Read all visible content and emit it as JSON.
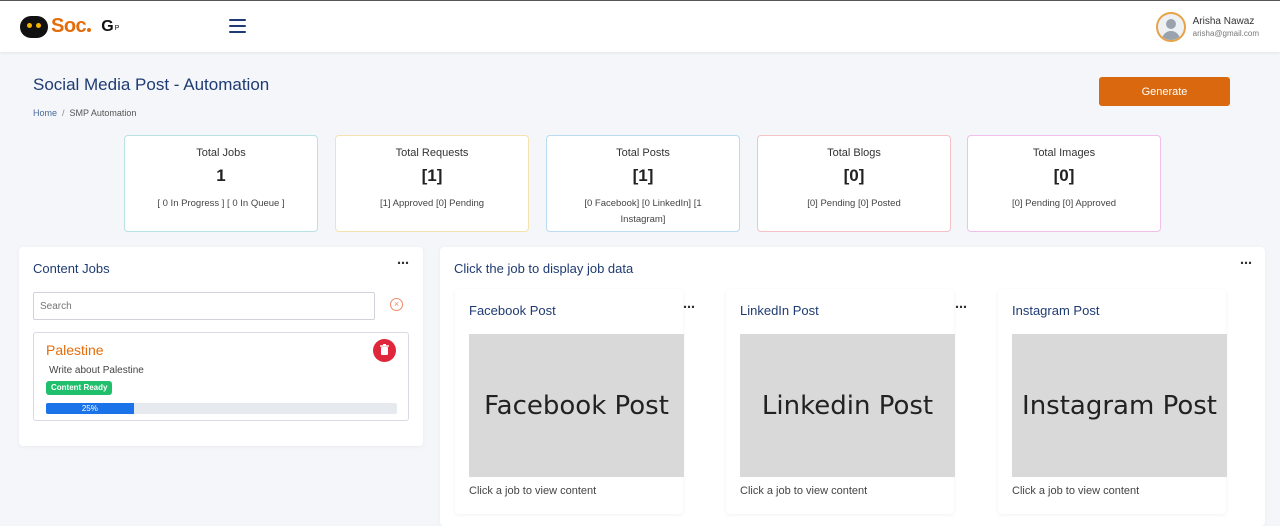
{
  "brand": {
    "name": "Soc",
    "g": "G",
    "p": "P"
  },
  "user": {
    "name": "Arisha Nawaz",
    "email": "arisha@gmail.com"
  },
  "page": {
    "title": "Social Media Post - Automation",
    "breadcrumb_home": "Home",
    "breadcrumb_sep": "/",
    "breadcrumb_current": "SMP Automation",
    "generate_label": "Generate"
  },
  "stats": [
    {
      "label": "Total Jobs",
      "value": "1",
      "sub": "[ 0 In Progress ]  [ 0 In Queue ]",
      "border": "#b8e2e4"
    },
    {
      "label": "Total Requests",
      "value": "[1]",
      "sub": "[1] Approved  [0] Pending",
      "border": "#f5e2b0"
    },
    {
      "label": "Total Posts",
      "value": "[1]",
      "sub": "[0 Facebook]  [0 LinkedIn]  [1 Instagram]",
      "border": "#b9dcf2"
    },
    {
      "label": "Total Blogs",
      "value": "[0]",
      "sub": "[0] Pending  [0] Posted",
      "border": "#f4c3c8"
    },
    {
      "label": "Total Images",
      "value": "[0]",
      "sub": "[0] Pending  [0] Approved",
      "border": "#f0c0ea"
    }
  ],
  "content_jobs": {
    "title": "Content Jobs",
    "menu": "⋯",
    "search_placeholder": "Search",
    "clear_icon": "×",
    "jobs": [
      {
        "title": "Palestine",
        "description": "Write about Palestine",
        "status": "Content Ready",
        "status_color": "#1fbf6c",
        "progress": 25,
        "progress_label": "25%"
      }
    ]
  },
  "job_data": {
    "title": "Click the job to display job data",
    "menu": "⋯",
    "posts": [
      {
        "title": "Facebook Post",
        "placeholder": "Facebook Post",
        "caption": "Click a job to view content",
        "menu": "⋯"
      },
      {
        "title": "LinkedIn Post",
        "placeholder": "Linkedin Post",
        "caption": "Click a job to view content",
        "menu": "⋯"
      },
      {
        "title": "Instagram Post",
        "placeholder": "Instagram Post",
        "caption": "Click a job to view content",
        "menu": "⋯"
      }
    ]
  },
  "colors": {
    "accent": "#d9680f",
    "brand_orange": "#e46c0a",
    "title_blue": "#1f3b73",
    "progress_blue": "#1a73e8",
    "delete_red": "#e0263a"
  }
}
